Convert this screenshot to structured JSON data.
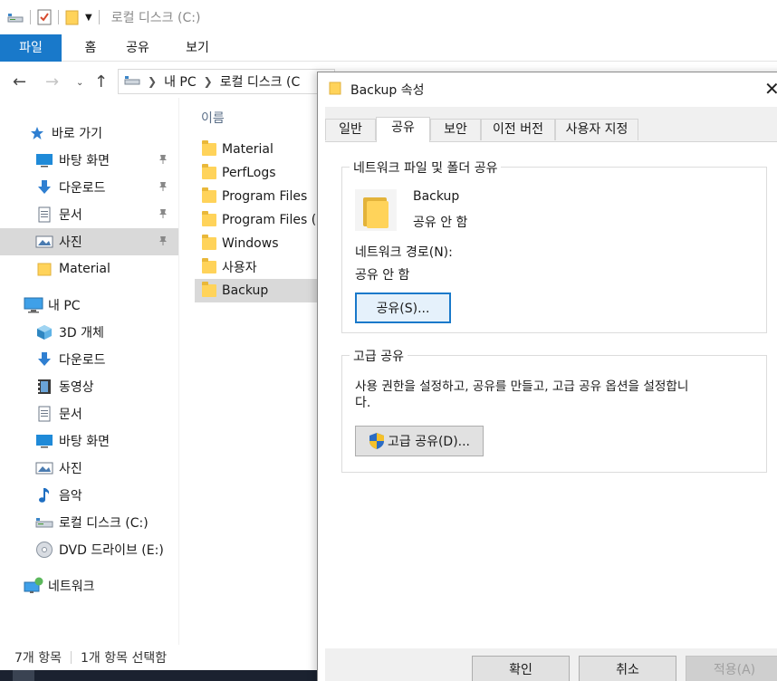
{
  "explorer": {
    "title": "로컬 디스크 (C:)",
    "ribbon_tabs": [
      "파일",
      "홈",
      "공유",
      "보기"
    ],
    "address": [
      "내 PC",
      "로컬 디스크 (C"
    ],
    "nav": {
      "quick_access": "바로 가기",
      "pinned": [
        {
          "label": "바탕 화면",
          "icon": "desktop-icon"
        },
        {
          "label": "다운로드",
          "icon": "download-icon"
        },
        {
          "label": "문서",
          "icon": "document-icon"
        },
        {
          "label": "사진",
          "icon": "pictures-icon"
        }
      ],
      "material": "Material",
      "this_pc": "내 PC",
      "pc_items": [
        {
          "label": "3D 개체",
          "icon": "3d-objects-icon"
        },
        {
          "label": "다운로드",
          "icon": "download-icon"
        },
        {
          "label": "동영상",
          "icon": "video-icon"
        },
        {
          "label": "문서",
          "icon": "document-icon"
        },
        {
          "label": "바탕 화면",
          "icon": "desktop-icon"
        },
        {
          "label": "사진",
          "icon": "pictures-icon"
        },
        {
          "label": "음악",
          "icon": "music-icon"
        },
        {
          "label": "로컬 디스크 (C:)",
          "icon": "drive-icon"
        },
        {
          "label": "DVD 드라이브 (E:)",
          "icon": "dvd-icon"
        }
      ],
      "network": "네트워크"
    },
    "column_header": "이름",
    "files": [
      "Material",
      "PerfLogs",
      "Program Files",
      "Program Files (",
      "Windows",
      "사용자",
      "Backup"
    ],
    "selected_file": "Backup",
    "status": {
      "count": "7개 항목",
      "selected": "1개 항목 선택함"
    }
  },
  "dialog": {
    "title": "Backup 속성",
    "tabs": [
      "일반",
      "공유",
      "보안",
      "이전 버전",
      "사용자 지정"
    ],
    "active_tab": "공유",
    "network_group": {
      "legend": "네트워크 파일 및 폴더 공유",
      "folder_name": "Backup",
      "share_state": "공유 안 함",
      "path_label": "네트워크 경로(N):",
      "path_value": "공유 안 함",
      "share_button": "공유(S)..."
    },
    "advanced_group": {
      "legend": "고급 공유",
      "description_line1": "사용 권한을 설정하고, 공유를 만들고, 고급 공유 옵션을 설정합니",
      "description_line2": "다.",
      "button": "고급 공유(D)..."
    },
    "footer": {
      "ok": "확인",
      "cancel": "취소",
      "apply": "적용(A)"
    }
  },
  "colors": {
    "accent": "#1979ca",
    "folder": "#ffd35a",
    "selection": "#d9d9d9"
  }
}
